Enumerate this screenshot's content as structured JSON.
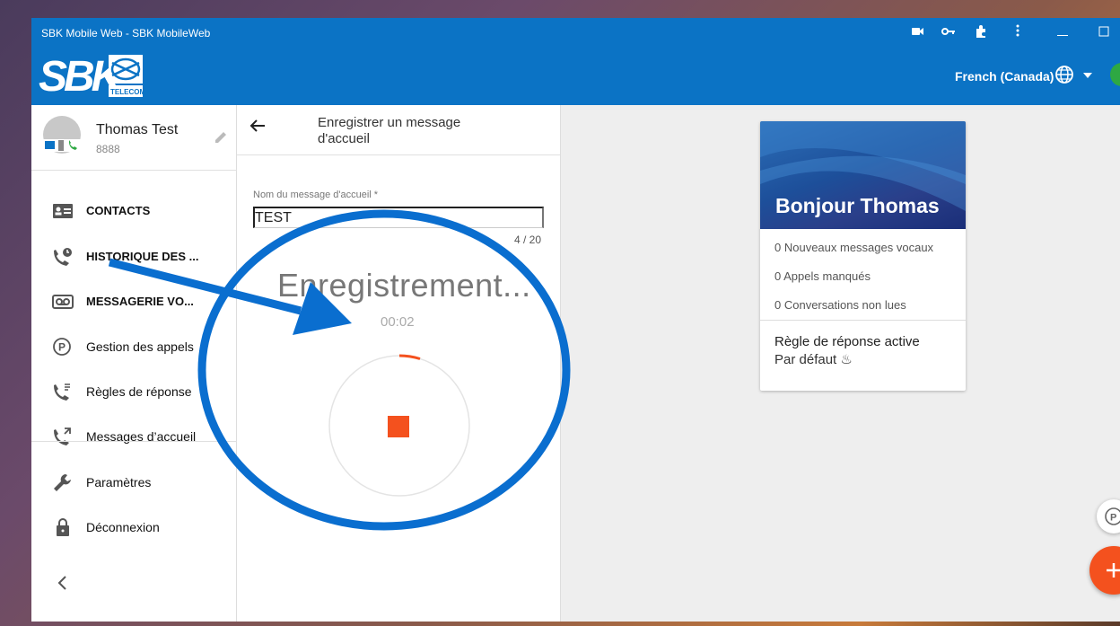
{
  "window": {
    "title": "SBK Mobile Web - SBK MobileWeb"
  },
  "appbar": {
    "language": "French (Canada)"
  },
  "profile": {
    "name": "Thomas Test",
    "extension": "8888"
  },
  "sidebar": {
    "items": [
      {
        "label": "CONTACTS",
        "icon": "contacts-card-icon"
      },
      {
        "label": "HISTORIQUE DES ...",
        "icon": "call-history-icon"
      },
      {
        "label": "MESSAGERIE VO...",
        "icon": "voicemail-icon"
      },
      {
        "label": "Gestion des appels",
        "icon": "parking-icon"
      },
      {
        "label": "Règles de réponse",
        "icon": "call-rules-icon"
      },
      {
        "label": "Messages d’accueil",
        "icon": "greeting-phone-icon"
      },
      {
        "label": "Paramètres",
        "icon": "wrench-icon"
      },
      {
        "label": "Déconnexion",
        "icon": "lock-icon"
      }
    ]
  },
  "middle": {
    "title": "Enregistrer un message d'accueil",
    "field_label": "Nom du message d'accueil *",
    "field_value": "TEST",
    "field_count": "4 / 20",
    "status": "Enregistrement...",
    "timer": "00:02"
  },
  "card": {
    "greeting": "Bonjour Thomas",
    "stats": [
      "0 Nouveaux messages vocaux",
      "0 Appels manqués",
      "0 Conversations non lues"
    ],
    "rule_title": "Règle de réponse active",
    "rule_value": "Par défaut ♨"
  },
  "colors": {
    "brand_blue": "#0b73c5",
    "record_orange": "#f4511e",
    "annotation_blue": "#0a6ecf"
  }
}
